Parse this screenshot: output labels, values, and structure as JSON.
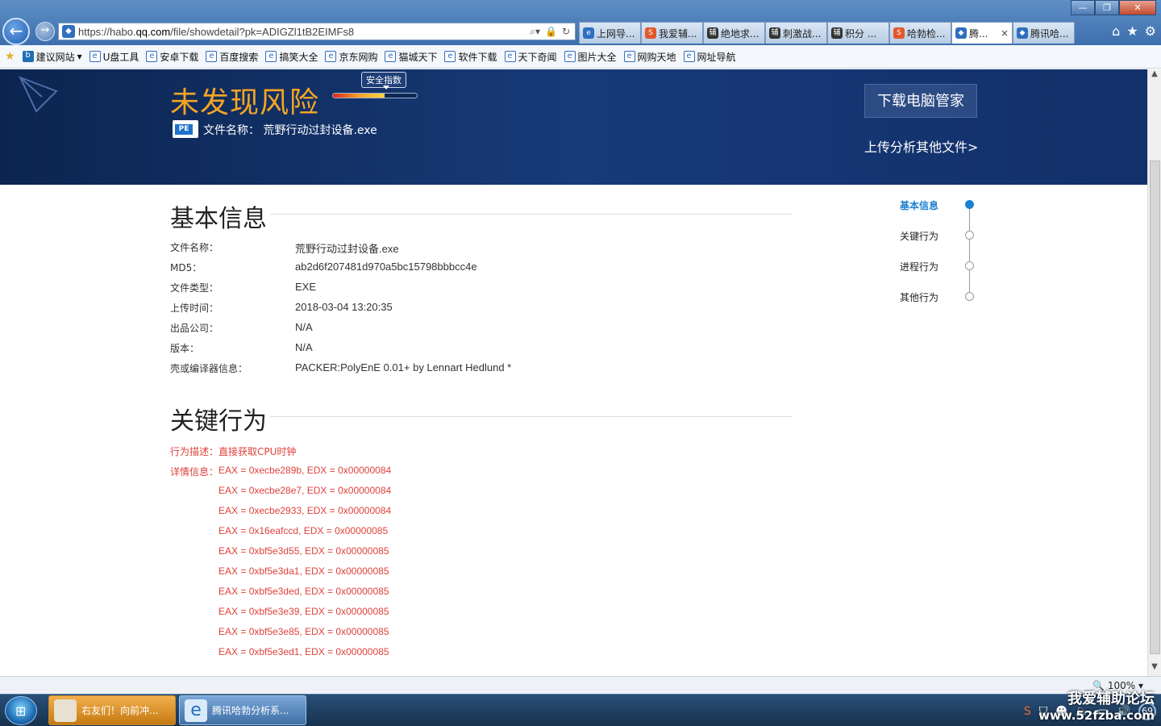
{
  "browser": {
    "url_prefix": "https://habo.",
    "url_domain": "qq.com",
    "url_rest": "/file/showdetail?pk=ADIGZl1tB2EIMFs8",
    "window_controls": [
      "—",
      "❐",
      "✕"
    ],
    "tabs": [
      {
        "label": "上网导...",
        "icon_color": "#2f6fc0",
        "icon_glyph": "e",
        "active": false
      },
      {
        "label": "我爱辅...",
        "icon_color": "#e2582b",
        "icon_glyph": "S",
        "active": false
      },
      {
        "label": "绝地求...",
        "icon_color": "#333333",
        "icon_glyph": "辅",
        "active": false
      },
      {
        "label": "刺激战...",
        "icon_color": "#333333",
        "icon_glyph": "辅",
        "active": false
      },
      {
        "label": "积分 ...",
        "icon_color": "#333333",
        "icon_glyph": "辅",
        "active": false
      },
      {
        "label": "哈勃检...",
        "icon_color": "#e2582b",
        "icon_glyph": "S",
        "active": false
      },
      {
        "label": "腾...",
        "icon_color": "#2f6fc0",
        "icon_glyph": "◆",
        "active": true
      },
      {
        "label": "腾讯哈...",
        "icon_color": "#2f6fc0",
        "icon_glyph": "◆",
        "active": false
      }
    ],
    "favorites": [
      {
        "label": "建议网站",
        "icon": "bing-icon"
      },
      {
        "label": "U盘工具",
        "icon": "ie-icon"
      },
      {
        "label": "安卓下载",
        "icon": "ie-icon"
      },
      {
        "label": "百度搜索",
        "icon": "ie-icon"
      },
      {
        "label": "搞笑大全",
        "icon": "ie-icon"
      },
      {
        "label": "京东网购",
        "icon": "ie-icon"
      },
      {
        "label": "猫城天下",
        "icon": "ie-icon"
      },
      {
        "label": "软件下载",
        "icon": "ie-icon"
      },
      {
        "label": "天下奇闻",
        "icon": "ie-icon"
      },
      {
        "label": "图片大全",
        "icon": "ie-icon"
      },
      {
        "label": "网购天地",
        "icon": "ie-icon"
      },
      {
        "label": "网址导航",
        "icon": "ie-icon"
      }
    ],
    "zoom": "100%"
  },
  "hero": {
    "risk_title": "未发现风险",
    "gauge_label": "安全指数",
    "gauge_level": 0.62,
    "file_icon_label": "PE",
    "file_name_label": "文件名称：",
    "file_name": "荒野行动过封设备.exe",
    "download_button": "下载电脑管家",
    "upload_link": "上传分析其他文件>"
  },
  "basic_info": {
    "title": "基本信息",
    "rows": [
      {
        "key": "文件名称：",
        "value": "荒野行动过封设备.exe"
      },
      {
        "key": "MD5：",
        "value": "ab2d6f207481d970a5bc15798bbbcc4e"
      },
      {
        "key": "文件类型：",
        "value": "EXE"
      },
      {
        "key": "上传时间：",
        "value": "2018-03-04 13:20:35"
      },
      {
        "key": "出品公司：",
        "value": "N/A"
      },
      {
        "key": "版本：",
        "value": "N/A"
      },
      {
        "key": "壳或编译器信息：",
        "value": "PACKER:PolyEnE 0.01+ by Lennart Hedlund *"
      }
    ]
  },
  "key_behavior": {
    "title": "关键行为",
    "desc_label": "行为描述：",
    "desc_value": "直接获取CPU时钟",
    "detail_label": "详情信息：",
    "details": [
      "EAX = 0xecbe289b, EDX = 0x00000084",
      "EAX = 0xecbe28e7, EDX = 0x00000084",
      "EAX = 0xecbe2933, EDX = 0x00000084",
      "EAX = 0x16eafccd, EDX = 0x00000085",
      "EAX = 0xbf5e3d55, EDX = 0x00000085",
      "EAX = 0xbf5e3da1, EDX = 0x00000085",
      "EAX = 0xbf5e3ded, EDX = 0x00000085",
      "EAX = 0xbf5e3e39, EDX = 0x00000085",
      "EAX = 0xbf5e3e85, EDX = 0x00000085",
      "EAX = 0xbf5e3ed1, EDX = 0x00000085"
    ]
  },
  "sidenav": {
    "items": [
      "基本信息",
      "关键行为",
      "进程行为",
      "其他行为"
    ],
    "active_index": 0
  },
  "taskbar": {
    "items": [
      "右友们！向前冲...",
      "腾讯哈勃分析系..."
    ],
    "tray_badge": "69",
    "watermark_line1": "我爱辅助论坛",
    "watermark_line2": "www.52fzba.com"
  },
  "colors": {
    "hero_bg": "#173a78",
    "risk_orange": "#f5a623",
    "accent_blue": "#1d7fd0",
    "behavior_red": "#e0413a"
  }
}
